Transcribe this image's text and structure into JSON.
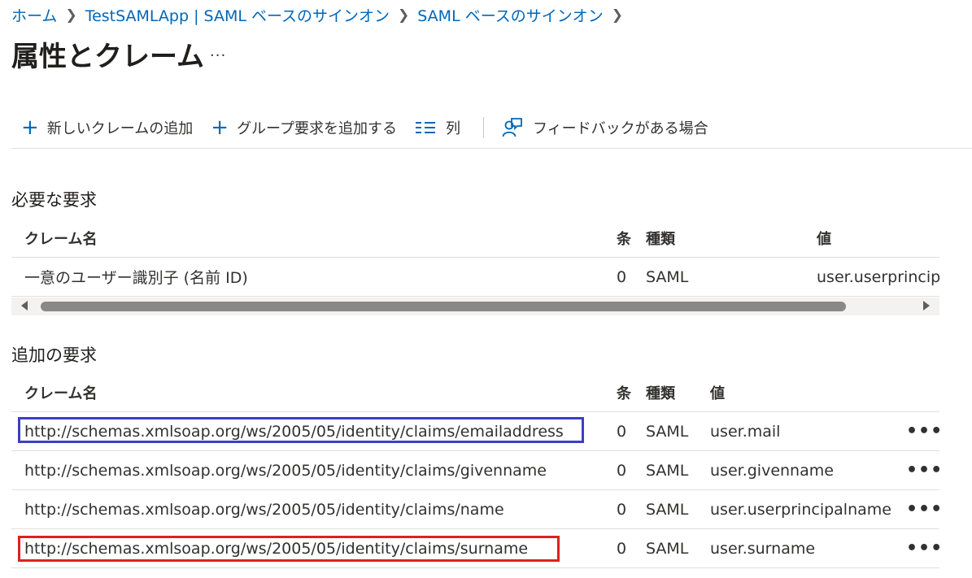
{
  "breadcrumb": {
    "home": "ホーム",
    "app": "TestSAMLApp | SAML ベースのサインオン",
    "current": "SAML ベースのサインオン"
  },
  "page": {
    "title": "属性とクレーム",
    "more": "..."
  },
  "toolbar": {
    "add_claim": "新しいクレームの追加",
    "add_group": "グループ要求を追加する",
    "columns": "列",
    "feedback": "フィードバックがある場合"
  },
  "required": {
    "title": "必要な要求",
    "headers": {
      "name": "クレーム名",
      "cond": "条",
      "type": "種類",
      "value": "値"
    },
    "rows": [
      {
        "name": "一意のユーザー識別子 (名前 ID)",
        "cond": "0",
        "type": "SAML",
        "value": "user.userprincipalname"
      }
    ]
  },
  "additional": {
    "title": "追加の要求",
    "headers": {
      "name": "クレーム名",
      "cond": "条",
      "type": "種類",
      "value": "値"
    },
    "rows": [
      {
        "name": "http://schemas.xmlsoap.org/ws/2005/05/identity/claims/emailaddress",
        "cond": "0",
        "type": "SAML",
        "value": "user.mail",
        "more": "•••"
      },
      {
        "name": "http://schemas.xmlsoap.org/ws/2005/05/identity/claims/givenname",
        "cond": "0",
        "type": "SAML",
        "value": "user.givenname",
        "more": "•••"
      },
      {
        "name": "http://schemas.xmlsoap.org/ws/2005/05/identity/claims/name",
        "cond": "0",
        "type": "SAML",
        "value": "user.userprincipalname",
        "more": "•••"
      },
      {
        "name": "http://schemas.xmlsoap.org/ws/2005/05/identity/claims/surname",
        "cond": "0",
        "type": "SAML",
        "value": "user.surname",
        "more": "•••"
      }
    ]
  },
  "colors": {
    "link": "#0067b8",
    "highlight_blue": "#3b3fc4",
    "highlight_red": "#e02020"
  },
  "icons": {
    "add": "plus-icon",
    "columns": "list-icon",
    "feedback": "feedback-person-icon",
    "chevron": "chevron-right-icon",
    "more": "more-ellipsis-icon"
  }
}
